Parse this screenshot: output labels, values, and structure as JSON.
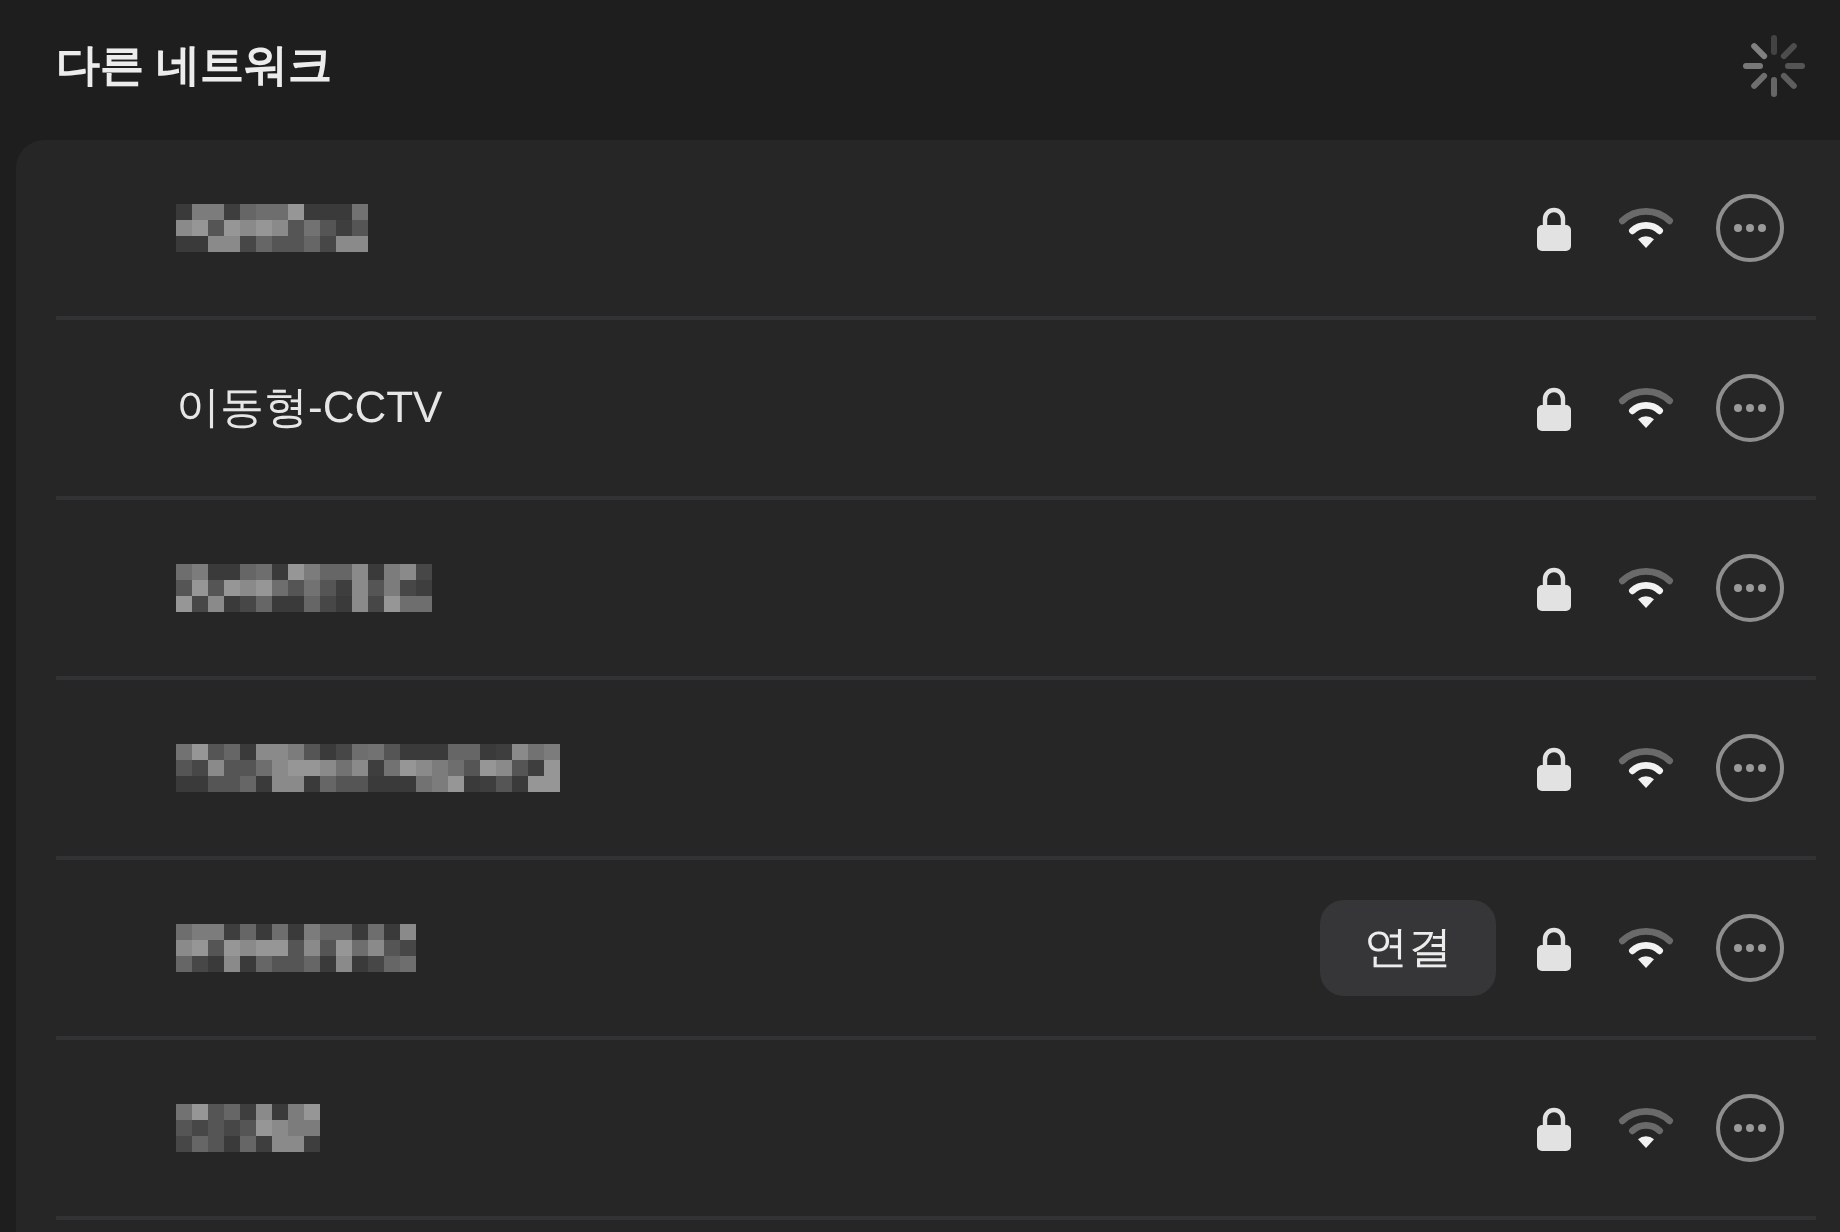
{
  "header": {
    "title": "다른 네트워크"
  },
  "networks": [
    {
      "kind": "redacted",
      "secured": true,
      "weak_signal": false
    },
    {
      "kind": "named",
      "name": "이동형-CCTV",
      "secured": true,
      "weak_signal": false
    },
    {
      "kind": "redacted",
      "secured": true,
      "weak_signal": false
    },
    {
      "kind": "redacted",
      "secured": true,
      "weak_signal": false
    },
    {
      "kind": "redacted",
      "connect_button": "연결",
      "secured": true,
      "weak_signal": false
    },
    {
      "kind": "redacted",
      "secured": true,
      "weak_signal": true
    }
  ]
}
